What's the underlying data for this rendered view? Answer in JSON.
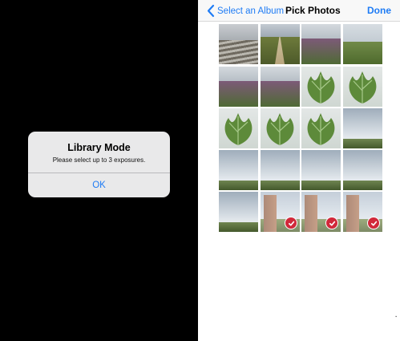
{
  "alert": {
    "title": "Library Mode",
    "message": "Please select up to 3 exposures.",
    "ok_label": "OK"
  },
  "navbar": {
    "back_label": "Select an Album",
    "title": "Pick Photos",
    "done_label": "Done",
    "back_icon": "chevron-left-icon"
  },
  "colors": {
    "accent": "#1f7cf5",
    "selection_badge": "#d1283a",
    "alert_background": "#e9e9ea"
  },
  "photo_grid": {
    "columns": 4,
    "rows": 5,
    "photos": [
      {
        "subject": "plowed-field",
        "selected": false
      },
      {
        "subject": "dirt-path",
        "selected": false
      },
      {
        "subject": "heather-field",
        "selected": false
      },
      {
        "subject": "grass-field",
        "selected": false
      },
      {
        "subject": "heather-field",
        "selected": false
      },
      {
        "subject": "heather-field",
        "selected": false
      },
      {
        "subject": "leaf-plant",
        "selected": false
      },
      {
        "subject": "leaf-plant",
        "selected": false
      },
      {
        "subject": "leaf-plant",
        "selected": false
      },
      {
        "subject": "leaf-plant",
        "selected": false
      },
      {
        "subject": "leaf-plant",
        "selected": false
      },
      {
        "subject": "cloudy-field",
        "selected": false
      },
      {
        "subject": "cloudy-field",
        "selected": false
      },
      {
        "subject": "cloudy-field",
        "selected": false
      },
      {
        "subject": "cloudy-field",
        "selected": false
      },
      {
        "subject": "cloudy-field",
        "selected": false
      },
      {
        "subject": "cloudy-field",
        "selected": false
      },
      {
        "subject": "castle-ruin",
        "selected": true
      },
      {
        "subject": "castle-ruin",
        "selected": true
      },
      {
        "subject": "castle-ruin",
        "selected": true
      }
    ]
  }
}
